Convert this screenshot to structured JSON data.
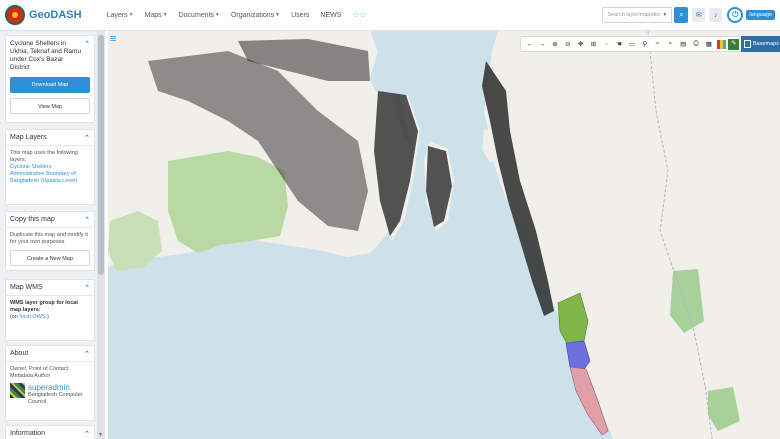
{
  "header": {
    "brand": "GeoDASH",
    "nav": [
      {
        "label": "Layers",
        "dropdown": true
      },
      {
        "label": "Maps",
        "dropdown": true
      },
      {
        "label": "Documents",
        "dropdown": true
      },
      {
        "label": "Organizations",
        "dropdown": true
      },
      {
        "label": "Users",
        "dropdown": false
      },
      {
        "label": "NEWS",
        "dropdown": false
      }
    ],
    "search_placeholder": "Search layer/map/doc",
    "language_label": "language"
  },
  "sidebar": {
    "map_panel": {
      "title": "Cyclone Shelters in Ukhia, Teknaf and Ramu under Cox's Bazar District",
      "download_label": "Download Map",
      "view_label": "View Map"
    },
    "layers_panel": {
      "title": "Map Layers",
      "text": "This map uses the following layers:",
      "layers": [
        "Cyclone Shelters",
        "Administrative Boundary of Bangladesh (Upazila Level)"
      ]
    },
    "copy_panel": {
      "title": "Copy this map",
      "text": "Duplicate this map and modify it for your own purposes",
      "button_label": "Create a New Map"
    },
    "wms_panel": {
      "title": "Map WMS",
      "text": "WMS layer group for local map layers:",
      "link_prefix": "(on ",
      "link_label": "local OWS",
      "link_suffix": " )"
    },
    "about_panel": {
      "title": "About",
      "roles": "Owner, Point of Contact, Metadata Author",
      "owner_name": "superadmin",
      "owner_org": "Bangladesh Computer Council"
    },
    "information_panel": {
      "title": "Information"
    }
  },
  "map": {
    "basemaps_label": "Basemaps",
    "colors": {
      "water": "#cce1ea",
      "land": "#f1efe9",
      "forest": "#b9d9a4",
      "park": "#a8d19a",
      "marker": "#2b2b2b",
      "region_green": "#7fb64a",
      "region_blue": "#6f6fe0",
      "region_pink": "#e0a0a8",
      "accent": "#2f8fd6"
    },
    "tools": [
      "back-icon",
      "forward-icon",
      "zoom-in-icon",
      "zoom-out-icon",
      "pan-icon",
      "zoom-box-icon",
      "circle-icon",
      "hand-icon",
      "ruler-icon",
      "location-pin-icon",
      "search-icon",
      "search-icon",
      "layers-icon",
      "print-icon",
      "table-icon",
      "palette-icon",
      "edit-icon"
    ]
  }
}
